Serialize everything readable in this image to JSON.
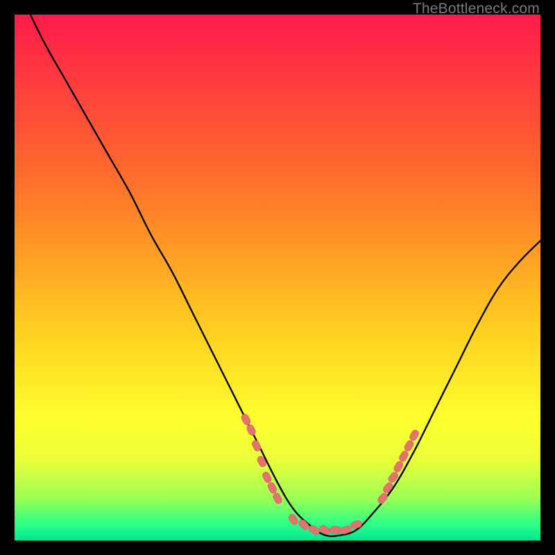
{
  "watermark": "TheBottleneck.com",
  "colors": {
    "bg_black": "#000000",
    "curve": "#000000",
    "marker_fill": "#e4726f",
    "marker_stroke": "#d85b58",
    "grad_top": "#ff1a4b",
    "grad_mid1": "#ff6a2c",
    "grad_mid2": "#ffcf1f",
    "grad_yellow": "#ffff2e",
    "grad_ylow": "#e8ff3a",
    "grad_green1": "#9bff55",
    "grad_green2": "#2bff8a",
    "grad_green3": "#00e58f"
  },
  "chart_data": {
    "type": "line",
    "title": "",
    "xlabel": "",
    "ylabel": "",
    "xlim": [
      0,
      100
    ],
    "ylim": [
      0,
      100
    ],
    "series": [
      {
        "name": "bottleneck-curve",
        "x": [
          3,
          6,
          10,
          14,
          18,
          22,
          26,
          30,
          34,
          38,
          42,
          46,
          50,
          53,
          56,
          59,
          62,
          65,
          68,
          72,
          76,
          80,
          84,
          88,
          92,
          96,
          100
        ],
        "y": [
          100,
          94,
          87,
          80,
          73,
          66,
          58,
          51,
          43,
          35,
          27,
          19,
          11,
          6,
          3,
          1,
          1,
          2,
          5,
          10,
          17,
          25,
          33,
          41,
          48,
          53,
          57
        ]
      }
    ],
    "markers": {
      "name": "salmon-dots",
      "points": [
        {
          "x": 44,
          "y": 23
        },
        {
          "x": 45,
          "y": 21
        },
        {
          "x": 46,
          "y": 18
        },
        {
          "x": 47,
          "y": 15
        },
        {
          "x": 48,
          "y": 12
        },
        {
          "x": 49,
          "y": 10
        },
        {
          "x": 50,
          "y": 8
        },
        {
          "x": 53,
          "y": 4
        },
        {
          "x": 55,
          "y": 3
        },
        {
          "x": 57,
          "y": 2
        },
        {
          "x": 59,
          "y": 2
        },
        {
          "x": 61,
          "y": 2
        },
        {
          "x": 63,
          "y": 2
        },
        {
          "x": 65,
          "y": 3
        },
        {
          "x": 70,
          "y": 8
        },
        {
          "x": 71,
          "y": 10
        },
        {
          "x": 72,
          "y": 12
        },
        {
          "x": 73,
          "y": 14
        },
        {
          "x": 74,
          "y": 16
        },
        {
          "x": 75,
          "y": 18
        },
        {
          "x": 76,
          "y": 20
        }
      ]
    }
  }
}
